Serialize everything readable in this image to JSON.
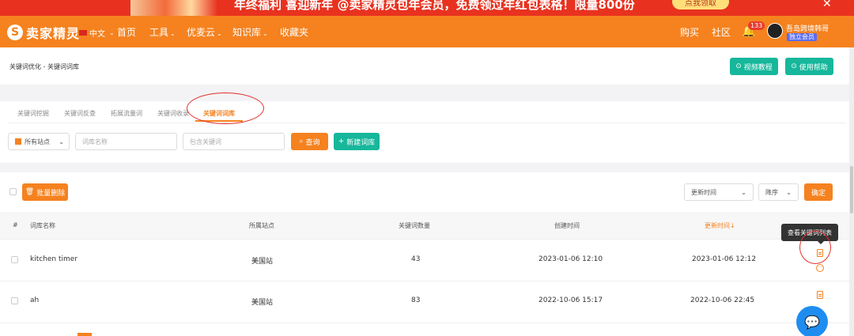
{
  "promo": {
    "text": "年终福利 喜迎新年 @卖家精灵包年会员，免费领过年红包表格！限量800份",
    "button": "点我领取",
    "close": "✕"
  },
  "nav": {
    "logo_mark": "S",
    "logo_text": "卖家精灵",
    "lang": "中文",
    "items": [
      "首页",
      "工具",
      "优麦云",
      "知识库",
      "收藏夹"
    ],
    "buy": "购买",
    "community": "社区",
    "notif_count": "133",
    "user_name": "吾岛跨境韩哥",
    "vip_label": "独立会员"
  },
  "header": {
    "breadcrumb": "关键词优化 - 关键词词库",
    "video_btn": "视频教程",
    "help_btn": "使用帮助"
  },
  "tabs": [
    "关键词挖掘",
    "关键词反查",
    "拓展流量词",
    "关键词收录",
    "关键词词库"
  ],
  "filters": {
    "site_select": "所有站点",
    "name_placeholder": "词库名称",
    "keyword_placeholder": "包含关键词",
    "query_btn": "查询",
    "new_btn": "新建词库"
  },
  "table": {
    "bulk_delete": "批量删除",
    "sort_field": "更新时间",
    "sort_order": "降序",
    "confirm_btn": "确定",
    "columns": [
      "#",
      "词库名称",
      "所属站点",
      "关键词数量",
      "创建时间",
      "更新时间↓"
    ],
    "rows": [
      {
        "name": "kitchen timer",
        "site": "美国站",
        "count": "43",
        "created": "2023-01-06 12:10",
        "updated": "2023-01-06 12:12"
      },
      {
        "name": "ah",
        "site": "美国站",
        "count": "83",
        "created": "2022-10-06 15:17",
        "updated": "2022-10-06 22:45"
      }
    ],
    "tooltip": "查看关键词列表"
  },
  "colors": {
    "orange": "#f5821f",
    "green": "#16b79b",
    "red": "#e2302b",
    "blue": "#1f8df0"
  }
}
